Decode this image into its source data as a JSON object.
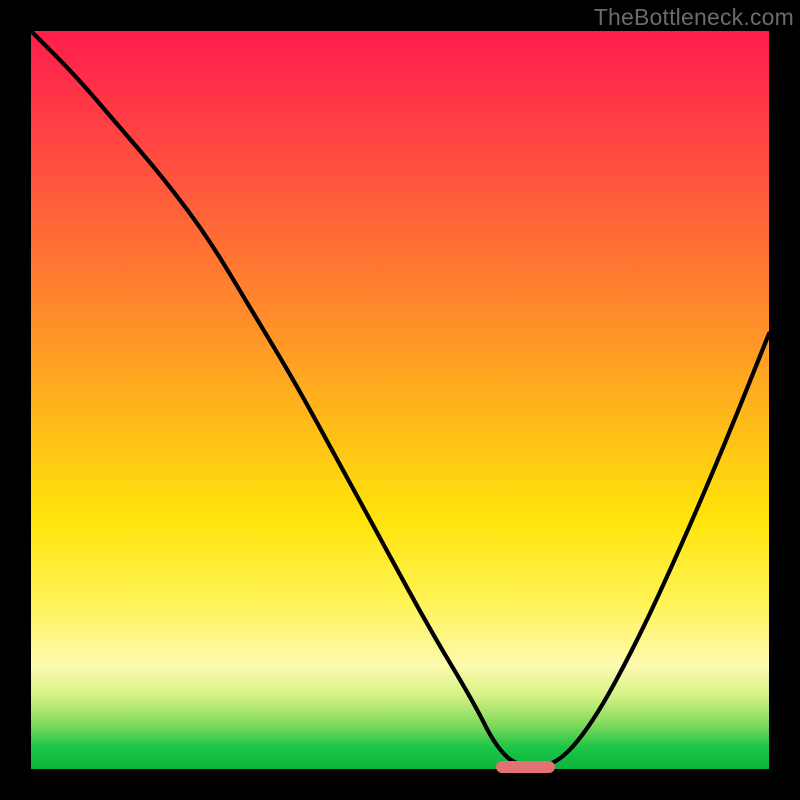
{
  "attribution": "TheBottleneck.com",
  "chart_data": {
    "type": "line",
    "title": "",
    "xlabel": "",
    "ylabel": "",
    "xlim": [
      0,
      100
    ],
    "ylim": [
      0,
      100
    ],
    "gradient_stops": [
      {
        "pos": 0,
        "color": "#ff1e4b"
      },
      {
        "pos": 7,
        "color": "#ff2f48"
      },
      {
        "pos": 22,
        "color": "#ff5a3c"
      },
      {
        "pos": 38,
        "color": "#ff8a2b"
      },
      {
        "pos": 52,
        "color": "#ffb71a"
      },
      {
        "pos": 66,
        "color": "#ffe40a"
      },
      {
        "pos": 78,
        "color": "#fff45a"
      },
      {
        "pos": 86,
        "color": "#fdfab0"
      },
      {
        "pos": 90,
        "color": "#d6f285"
      },
      {
        "pos": 94,
        "color": "#7fd95c"
      },
      {
        "pos": 97,
        "color": "#1ec648"
      },
      {
        "pos": 100,
        "color": "#0ab53d"
      }
    ],
    "series": [
      {
        "name": "bottleneck-curve",
        "x": [
          0,
          6,
          12,
          18,
          24,
          30,
          36,
          42,
          48,
          54,
          60,
          63,
          66,
          71,
          76,
          82,
          88,
          94,
          100
        ],
        "y": [
          100,
          94,
          87,
          80,
          72,
          62,
          52,
          41,
          30,
          19,
          9,
          3,
          0.3,
          0.3,
          6,
          17,
          30,
          44,
          59
        ]
      }
    ],
    "optimum_marker": {
      "x_start": 63,
      "x_end": 71,
      "y": 0.3,
      "color": "#e37272"
    }
  }
}
